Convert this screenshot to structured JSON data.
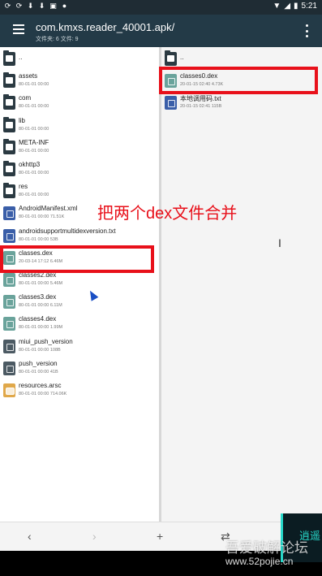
{
  "status_bar": {
    "time": "5:21"
  },
  "app_bar": {
    "title": "com.kmxs.reader_40001.apk/",
    "subtitle": "文件夹: 6  文件: 9"
  },
  "left_pane": {
    "items": [
      {
        "name": "..",
        "meta": "",
        "icon": "folder-icon",
        "type": "folder"
      },
      {
        "name": "assets",
        "meta": "80-01-01 00:00",
        "icon": "folder-icon",
        "type": "folder"
      },
      {
        "name": "com",
        "meta": "80-01-01 00:00",
        "icon": "folder-icon",
        "type": "folder"
      },
      {
        "name": "lib",
        "meta": "80-01-01 00:00",
        "icon": "folder-icon",
        "type": "folder"
      },
      {
        "name": "META-INF",
        "meta": "80-01-01 00:00",
        "icon": "folder-icon",
        "type": "folder"
      },
      {
        "name": "okhttp3",
        "meta": "80-01-01 00:00",
        "icon": "folder-icon",
        "type": "folder"
      },
      {
        "name": "res",
        "meta": "80-01-01 00:00",
        "icon": "folder-icon",
        "type": "folder"
      },
      {
        "name": "AndroidManifest.xml",
        "meta": "80-01-01 00:00   71.51K",
        "icon": "xml-file-icon",
        "type": "blue"
      },
      {
        "name": "androidsupportmultidexversion.txt",
        "meta": "80-01-01 00:00   53B",
        "icon": "text-file-icon",
        "type": "blue"
      },
      {
        "name": "classes.dex",
        "meta": "20-03-14 17:12   6.46M",
        "icon": "dex-file-icon",
        "type": "teal"
      },
      {
        "name": "classes2.dex",
        "meta": "80-01-01 00:00   5.46M",
        "icon": "dex-file-icon",
        "type": "teal"
      },
      {
        "name": "classes3.dex",
        "meta": "80-01-01 00:00   6.11M",
        "icon": "dex-file-icon",
        "type": "teal"
      },
      {
        "name": "classes4.dex",
        "meta": "80-01-01 00:00   1.99M",
        "icon": "dex-file-icon",
        "type": "teal"
      },
      {
        "name": "miui_push_version",
        "meta": "80-01-01 00:00   108B",
        "icon": "file-icon",
        "type": "gray"
      },
      {
        "name": "push_version",
        "meta": "80-01-01 00:00   41B",
        "icon": "file-icon",
        "type": "gray"
      },
      {
        "name": "resources.arsc",
        "meta": "80-01-01 00:00   714.06K",
        "icon": "archive-icon",
        "type": "yellow"
      }
    ]
  },
  "right_pane": {
    "items": [
      {
        "name": "..",
        "meta": "",
        "icon": "folder-icon",
        "type": "folder"
      },
      {
        "name": "classes0.dex",
        "meta": "20-01-15 02:40   4.73K",
        "icon": "dex-file-icon",
        "type": "teal"
      },
      {
        "name": "本地调用码.txt",
        "meta": "20-01-15 02:41   115B",
        "icon": "text-file-icon",
        "type": "blue"
      }
    ]
  },
  "annotation": {
    "text": "把两个dex文件合并"
  },
  "watermark": {
    "line1": "吾爱破解论坛",
    "line2": "www.52pojie.cn",
    "badge": "逍遥"
  },
  "colors": {
    "app_bar": "#233a47",
    "highlight": "#e8101a",
    "dex_icon": "#6aa39b",
    "doc_icon": "#3a5ea8"
  }
}
